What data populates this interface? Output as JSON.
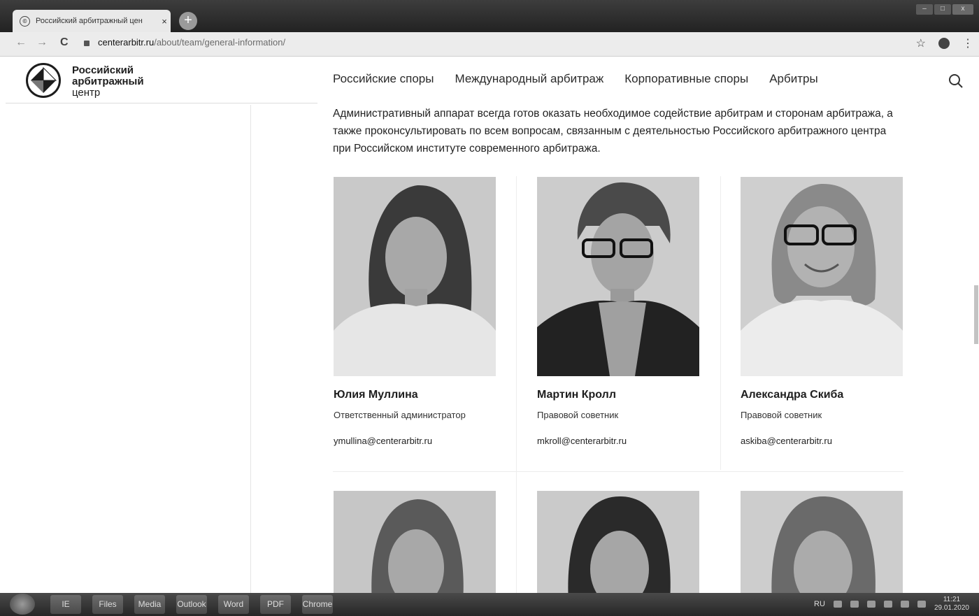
{
  "browser": {
    "tab_title": "Российский арбитражный цен",
    "tab_close": "×",
    "new_tab": "+",
    "url_domain": "centerarbitr.ru",
    "url_path": "/about/team/general-information/",
    "back": "←",
    "forward": "→",
    "reload": "C",
    "star": "☆",
    "menu": "⋮"
  },
  "site": {
    "logo_line1": "Российский",
    "logo_line2": "арбитражный",
    "logo_line3": "центр",
    "nav": [
      "Российские споры",
      "Международный арбитраж",
      "Корпоративные споры",
      "Арбитры"
    ]
  },
  "content": {
    "intro": "Административный аппарат всегда готов оказать необходимое содействие арбитрам и сторонам арбитража, а также проконсультировать по всем вопросам, связанным с деятельностью Российского арбитражного центра при Российском институте современного арбитража.",
    "team": [
      {
        "name": "Юлия Муллина",
        "role": "Ответственный администратор",
        "email": "ymullina@centerarbitr.ru"
      },
      {
        "name": "Мартин Кролл",
        "role": "Правовой советник",
        "email": "mkroll@centerarbitr.ru"
      },
      {
        "name": "Александра Скиба",
        "role": "Правовой советник",
        "email": "askiba@centerarbitr.ru"
      }
    ]
  },
  "taskbar": {
    "lang": "RU",
    "time": "11:21",
    "date": "29.01.2020",
    "apps": [
      "IE",
      "Files",
      "Media",
      "Outlook",
      "Word",
      "PDF",
      "Chrome"
    ]
  },
  "colors": {
    "text": "#1e1e1e",
    "photo_bg": "#c8c8c8",
    "chrome_bg": "#ececec"
  }
}
